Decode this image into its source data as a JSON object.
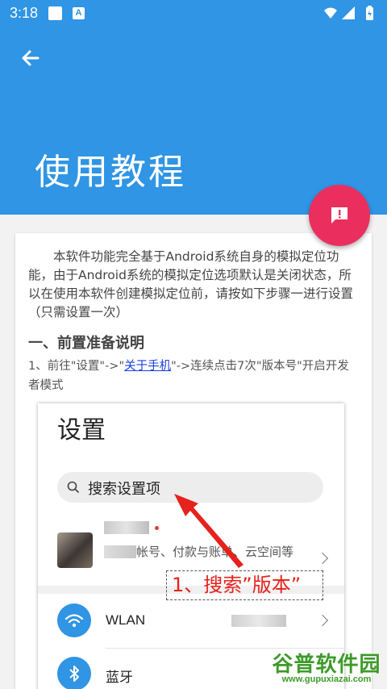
{
  "status_bar": {
    "time": "3:18",
    "notif_letter": "A"
  },
  "appbar": {
    "title": "使用教程"
  },
  "content": {
    "intro": "本软件功能完全基于Android系统自身的模拟定位功能，由于Android系统的模拟定位选项默认是关闭状态，所以在使用本软件创建模拟定位前，请按如下步骤一进行设置（只需设置一次）",
    "section_heading": "一、前置准备说明",
    "step1_before": "1、前往\"设置\"->\"",
    "step1_link": "关于手机",
    "step1_after": "\"->连续点击7次\"版本号\"开启开发者模式"
  },
  "embedded_screenshot": {
    "title": "设置",
    "search_placeholder": "搜索设置项",
    "account_subtitle": "帐号、付款与账单、云空间等",
    "wlan_label": "WLAN",
    "bluetooth_label": "蓝牙",
    "annotation": "1、搜索”版本”"
  },
  "watermark": {
    "name": "谷普软件园",
    "url": "www.gupuxiazai.com"
  },
  "colors": {
    "primary": "#2f95e4",
    "fab": "#ea2f5e",
    "link": "#1a3fe0",
    "annotation": "#e5221c"
  }
}
